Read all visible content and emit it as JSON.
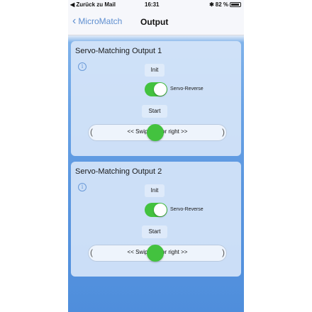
{
  "status_bar": {
    "back_app": "◀ Zurück zu Mail",
    "time": "16:31",
    "battery": "82 %",
    "bluetooth": "✱"
  },
  "nav": {
    "back_label": "MicroMatch",
    "title": "Output"
  },
  "cards": [
    {
      "heading": "Servo-Matching Output 1",
      "info_icon": "i",
      "init_label": "Init",
      "toggle_label": "Servo-Reverse",
      "toggle_on": true,
      "start_label": "Start",
      "swipe_text": "<< Swipe left or right >>"
    },
    {
      "heading": "Servo-Matching Output 2",
      "info_icon": "i",
      "init_label": "Init",
      "toggle_label": "Servo-Reverse",
      "toggle_on": true,
      "start_label": "Start",
      "swipe_text": "<< Swipe left or right >>"
    }
  ],
  "colors": {
    "accent": "#5f8fd0",
    "toggle_on": "#43c23f",
    "background": "#5b97e0"
  }
}
